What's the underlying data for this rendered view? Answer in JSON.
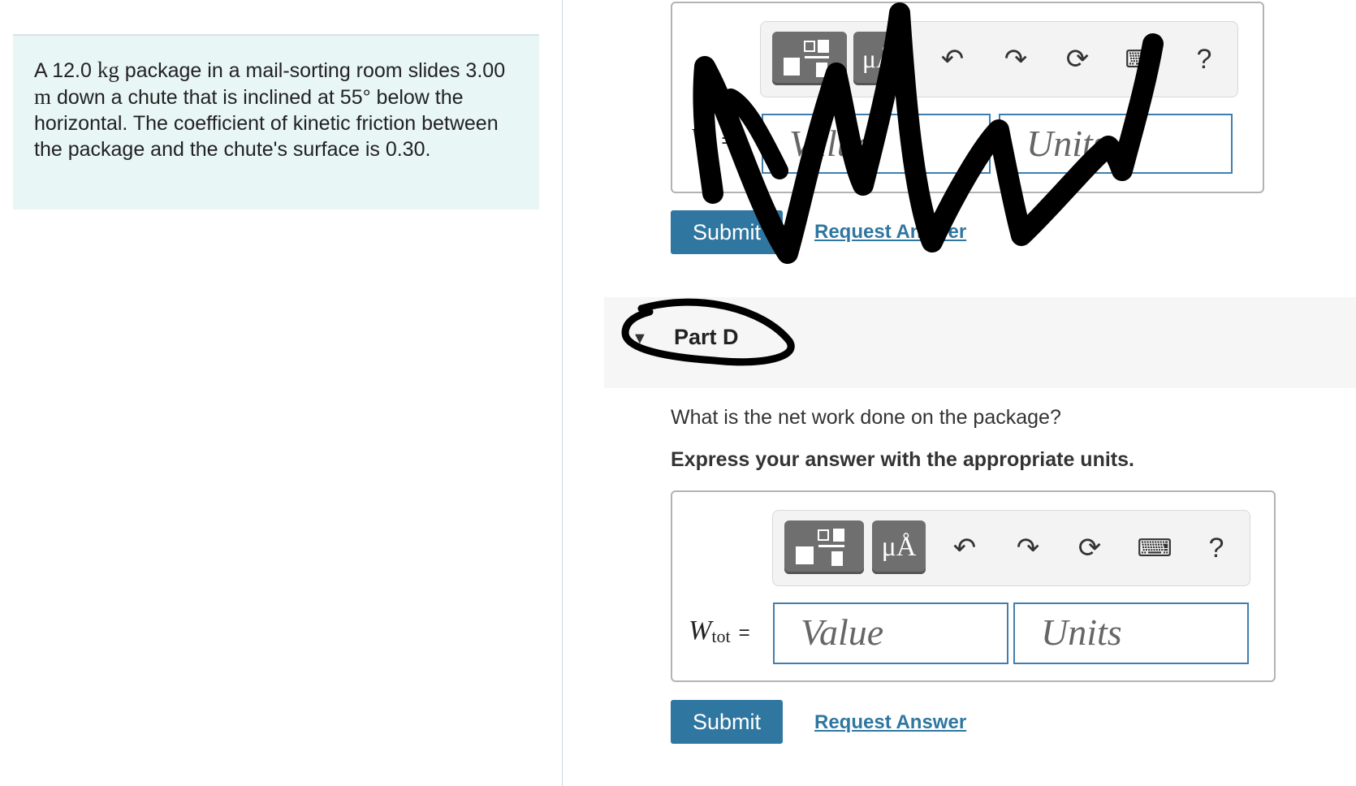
{
  "problem": {
    "text_parts": [
      "A 12.0 ",
      "kg",
      " package in a mail-sorting room slides 3.00 ",
      "m",
      " down a chute that is inclined at 55° below the horizontal. The coefficient of kinetic friction between the package and the chute's surface is 0.30."
    ]
  },
  "partC": {
    "label_prefix": "W",
    "equals": "=",
    "value_placeholder": "Value",
    "units_placeholder": "Units",
    "mu_label": "μÅ",
    "help": "?",
    "submit_label": "Submit",
    "request_label": "Request Answer"
  },
  "partD": {
    "title": "Part D",
    "question": "What is the net work done on the package?",
    "instruction": "Express your answer with the appropriate units.",
    "label_main": "W",
    "label_sub": "tot",
    "equals": "=",
    "value_placeholder": "Value",
    "units_placeholder": "Units",
    "mu_label": "μÅ",
    "help": "?",
    "submit_label": "Submit",
    "request_label": "Request Answer"
  },
  "icons": [
    "templates-icon",
    "symbols-icon",
    "undo-icon",
    "redo-icon",
    "reset-icon",
    "keyboard-icon",
    "help-icon"
  ],
  "colors": {
    "accent": "#2f77a0",
    "input_border": "#3f7fb0",
    "problem_bg": "#e8f6f5"
  }
}
